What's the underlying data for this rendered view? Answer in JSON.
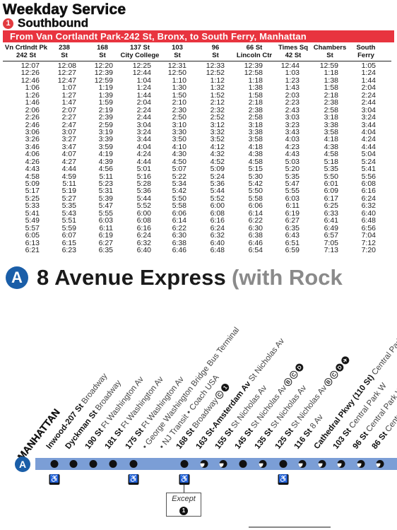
{
  "header": {
    "title": "Weekday Service",
    "direction_bullet": "1",
    "direction": "Southbound",
    "route_banner": "From Van Cortlandt Park-242 St, Bronx, to South Ferry, Manhattan",
    "colors": {
      "route_red": "#e8343f",
      "a_blue": "#1a5ea8",
      "strip_blue": "#7b9ed6"
    }
  },
  "timetable": {
    "columns": [
      [
        "Vn Crtlndt Pk",
        "242 St"
      ],
      [
        "238",
        "St"
      ],
      [
        "168",
        "St"
      ],
      [
        "137 St",
        "City College"
      ],
      [
        "103",
        "St"
      ],
      [
        "96",
        "St"
      ],
      [
        "66 St",
        "Lincoln Ctr"
      ],
      [
        "Times Sq",
        "42 St"
      ],
      [
        "Chambers",
        "St"
      ],
      [
        "South",
        "Ferry"
      ]
    ],
    "rows": [
      [
        "12:07",
        "12:08",
        "12:20",
        "12:25",
        "12:31",
        "12:33",
        "12:39",
        "12:44",
        "12:59",
        "1:05"
      ],
      [
        "12:26",
        "12:27",
        "12:39",
        "12:44",
        "12:50",
        "12:52",
        "12:58",
        "1:03",
        "1:18",
        "1:24"
      ],
      [
        "12:46",
        "12:47",
        "12:59",
        "1:04",
        "1:10",
        "1:12",
        "1:18",
        "1:23",
        "1:38",
        "1:44"
      ],
      [
        "1:06",
        "1:07",
        "1:19",
        "1:24",
        "1:30",
        "1:32",
        "1:38",
        "1:43",
        "1:58",
        "2:04"
      ],
      [
        "1:26",
        "1:27",
        "1:39",
        "1:44",
        "1:50",
        "1:52",
        "1:58",
        "2:03",
        "2:18",
        "2:24"
      ],
      [
        "1:46",
        "1:47",
        "1:59",
        "2:04",
        "2:10",
        "2:12",
        "2:18",
        "2:23",
        "2:38",
        "2:44"
      ],
      [
        "2:06",
        "2:07",
        "2:19",
        "2:24",
        "2:30",
        "2:32",
        "2:38",
        "2:43",
        "2:58",
        "3:04"
      ],
      [
        "2:26",
        "2:27",
        "2:39",
        "2:44",
        "2:50",
        "2:52",
        "2:58",
        "3:03",
        "3:18",
        "3:24"
      ],
      [
        "2:46",
        "2:47",
        "2:59",
        "3:04",
        "3:10",
        "3:12",
        "3:18",
        "3:23",
        "3:38",
        "3:44"
      ],
      [
        "3:06",
        "3:07",
        "3:19",
        "3:24",
        "3:30",
        "3:32",
        "3:38",
        "3:43",
        "3:58",
        "4:04"
      ],
      [
        "3:26",
        "3:27",
        "3:39",
        "3:44",
        "3:50",
        "3:52",
        "3:58",
        "4:03",
        "4:18",
        "4:24"
      ],
      [
        "3:46",
        "3:47",
        "3:59",
        "4:04",
        "4:10",
        "4:12",
        "4:18",
        "4:23",
        "4:38",
        "4:44"
      ],
      [
        "4:06",
        "4:07",
        "4:19",
        "4:24",
        "4:30",
        "4:32",
        "4:38",
        "4:43",
        "4:58",
        "5:04"
      ],
      [
        "4:26",
        "4:27",
        "4:39",
        "4:44",
        "4:50",
        "4:52",
        "4:58",
        "5:03",
        "5:18",
        "5:24"
      ],
      [
        "4:43",
        "4:44",
        "4:56",
        "5:01",
        "5:07",
        "5:09",
        "5:15",
        "5:20",
        "5:35",
        "5:41"
      ],
      [
        "4:58",
        "4:59",
        "5:11",
        "5:16",
        "5:22",
        "5:24",
        "5:30",
        "5:35",
        "5:50",
        "5:56"
      ],
      [
        "5:09",
        "5:11",
        "5:23",
        "5:28",
        "5:34",
        "5:36",
        "5:42",
        "5:47",
        "6:01",
        "6:08"
      ],
      [
        "5:17",
        "5:19",
        "5:31",
        "5:36",
        "5:42",
        "5:44",
        "5:50",
        "5:55",
        "6:09",
        "6:16"
      ],
      [
        "5:25",
        "5:27",
        "5:39",
        "5:44",
        "5:50",
        "5:52",
        "5:58",
        "6:03",
        "6:17",
        "6:24"
      ],
      [
        "5:33",
        "5:35",
        "5:47",
        "5:52",
        "5:58",
        "6:00",
        "6:06",
        "6:11",
        "6:25",
        "6:32"
      ],
      [
        "5:41",
        "5:43",
        "5:55",
        "6:00",
        "6:06",
        "6:08",
        "6:14",
        "6:19",
        "6:33",
        "6:40"
      ],
      [
        "5:49",
        "5:51",
        "6:03",
        "6:08",
        "6:14",
        "6:16",
        "6:22",
        "6:27",
        "6:41",
        "6:48"
      ],
      [
        "5:57",
        "5:59",
        "6:11",
        "6:16",
        "6:22",
        "6:24",
        "6:30",
        "6:35",
        "6:49",
        "6:56"
      ],
      [
        "6:05",
        "6:07",
        "6:19",
        "6:24",
        "6:30",
        "6:32",
        "6:38",
        "6:43",
        "6:57",
        "7:04"
      ],
      [
        "6:13",
        "6:15",
        "6:27",
        "6:32",
        "6:38",
        "6:40",
        "6:46",
        "6:51",
        "7:05",
        "7:12"
      ],
      [
        "6:21",
        "6:23",
        "6:35",
        "6:40",
        "6:46",
        "6:48",
        "6:54",
        "6:59",
        "7:13",
        "7:20"
      ]
    ]
  },
  "line": {
    "bullet": "A",
    "name": "8 Avenue Express",
    "note": "(with Rock"
  },
  "map": {
    "borough": "MANHATTAN",
    "line_bullet": "A",
    "except_label": "Except",
    "except_bullet": "1",
    "stations": [
      {
        "name": "Inwood-207 St",
        "street": "Broadway",
        "service": "full",
        "ada": true,
        "extra": ""
      },
      {
        "name": "Dyckman St",
        "street": "Broadway",
        "service": "full",
        "ada": false,
        "extra": ""
      },
      {
        "name": "190 St",
        "street": "Ft Washington Av",
        "service": "full",
        "ada": false,
        "extra": ""
      },
      {
        "name": "181 St",
        "street": "Ft Washington Av",
        "service": "full",
        "ada": false,
        "extra": ""
      },
      {
        "name": "175 St",
        "street": "Ft Washington Av",
        "service": "full",
        "ada": true,
        "extra": ""
      },
      {
        "name": "",
        "street": "• George Washington Bridge Bus Terminal",
        "service": "none",
        "ada": false,
        "extra": ""
      },
      {
        "name": "",
        "street": "• NJ Transit • Coach USA",
        "service": "none",
        "ada": false,
        "extra": ""
      },
      {
        "name": "168 St",
        "street": "Broadway",
        "service": "full",
        "ada": true,
        "extra": "C 1"
      },
      {
        "name": "163 St-Amsterdam Av",
        "street": "St Nicholas Av",
        "service": "moon",
        "ada": false,
        "extra": ""
      },
      {
        "name": "155 St",
        "street": "St Nicholas Av",
        "service": "moon",
        "ada": false,
        "extra": ""
      },
      {
        "name": "145 St",
        "street": "St Nicholas Av",
        "service": "full",
        "ada": false,
        "extra": "B C D"
      },
      {
        "name": "135 St",
        "street": "St Nicholas Av",
        "service": "moon",
        "ada": false,
        "extra": ""
      },
      {
        "name": "125 St",
        "street": "St Nicholas Av",
        "service": "full",
        "ada": true,
        "extra": "B C D ✈"
      },
      {
        "name": "116 St",
        "street": "8 Av",
        "service": "moon",
        "ada": false,
        "extra": ""
      },
      {
        "name": "Cathedral Pkwy (110 St)",
        "street": "Central Park W",
        "service": "moon",
        "ada": false,
        "extra": ""
      },
      {
        "name": "103 St",
        "street": "Central Park W",
        "service": "moon",
        "ada": false,
        "extra": ""
      },
      {
        "name": "96 St",
        "street": "Central Park W",
        "service": "moon",
        "ada": false,
        "extra": ""
      },
      {
        "name": "86 St",
        "street": "Central Park W",
        "service": "moon",
        "ada": false,
        "extra": ""
      }
    ],
    "transfers": {
      "168": [
        {
          "label": "C",
          "solid": false
        },
        {
          "label": "1",
          "solid": true
        }
      ],
      "145": [
        {
          "label": "B",
          "solid": false
        },
        {
          "label": "C",
          "solid": false
        },
        {
          "label": "D",
          "solid": true
        }
      ],
      "125": [
        {
          "label": "B",
          "solid": false
        },
        {
          "label": "C",
          "solid": false
        },
        {
          "label": "D",
          "solid": true
        },
        {
          "label": "✈",
          "solid": true
        }
      ]
    }
  }
}
